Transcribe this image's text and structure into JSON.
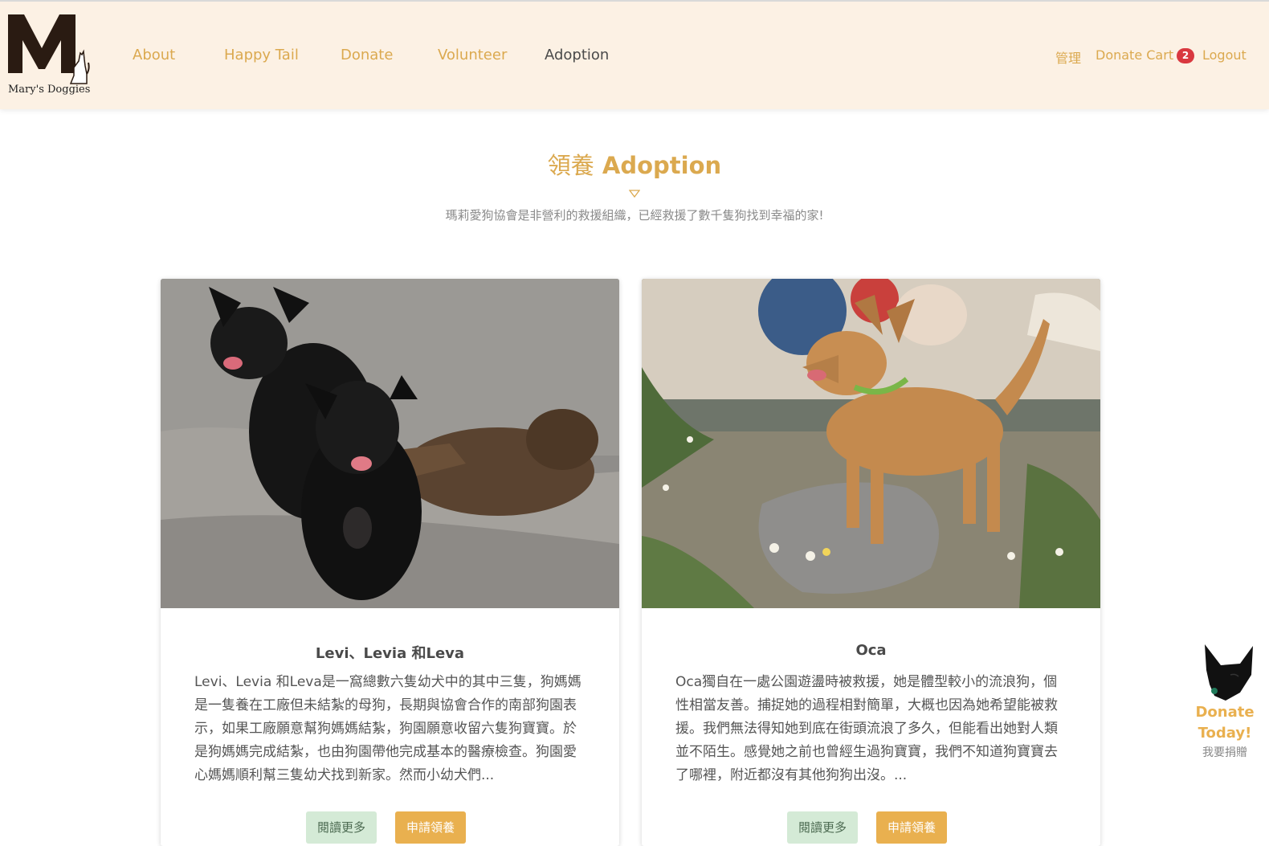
{
  "brand": {
    "name": "Mary's Doggies"
  },
  "nav": {
    "links": [
      "About",
      "Happy Tail",
      "Donate",
      "Volunteer",
      "Adoption"
    ],
    "admin": "管理",
    "cart_label": "Donate Cart",
    "cart_count": "2",
    "logout": "Logout"
  },
  "page": {
    "title_zh": "領養",
    "title_en": "Adoption",
    "subtitle": "瑪莉愛狗協會是非營利的救援組織，已經救援了數千隻狗找到幸福的家!"
  },
  "cards": [
    {
      "title": "Levi、Levia 和Leva",
      "description": "Levi、Levia 和Leva是一窩總數六隻幼犬中的其中三隻，狗媽媽是一隻養在工廠但未結紮的母狗，長期與協會合作的南部狗園表示，如果工廠願意幫狗媽媽結紮，狗園願意收留六隻狗寶寶。於是狗媽媽完成結紮，也由狗園帶他完成基本的醫療檢查。狗園愛心媽媽順利幫三隻幼犬找到新家。然而小幼犬們...",
      "read_more": "閱讀更多",
      "apply": "申請領養"
    },
    {
      "title": "Oca",
      "description": "Oca獨自在一處公園遊盪時被救援，她是體型較小的流浪狗，個性相當友善。捕捉她的過程相對簡單，大概也因為她希望能被救援。我們無法得知她到底在街頭流浪了多久，但能看出她對人類並不陌生。感覺她之前也曾經生過狗寶寶，我們不知道狗寶寶去了哪裡，附近都沒有其他狗狗出沒。...",
      "read_more": "閱讀更多",
      "apply": "申請領養"
    }
  ],
  "float_donate": {
    "title": "Donate Today!",
    "subtitle": "我要捐贈"
  },
  "colors": {
    "accent": "#dba94f",
    "navbar_bg": "#fcf1e4",
    "badge": "#d9383f",
    "button_apply": "#e9b04f",
    "button_more": "#d4ead6"
  }
}
